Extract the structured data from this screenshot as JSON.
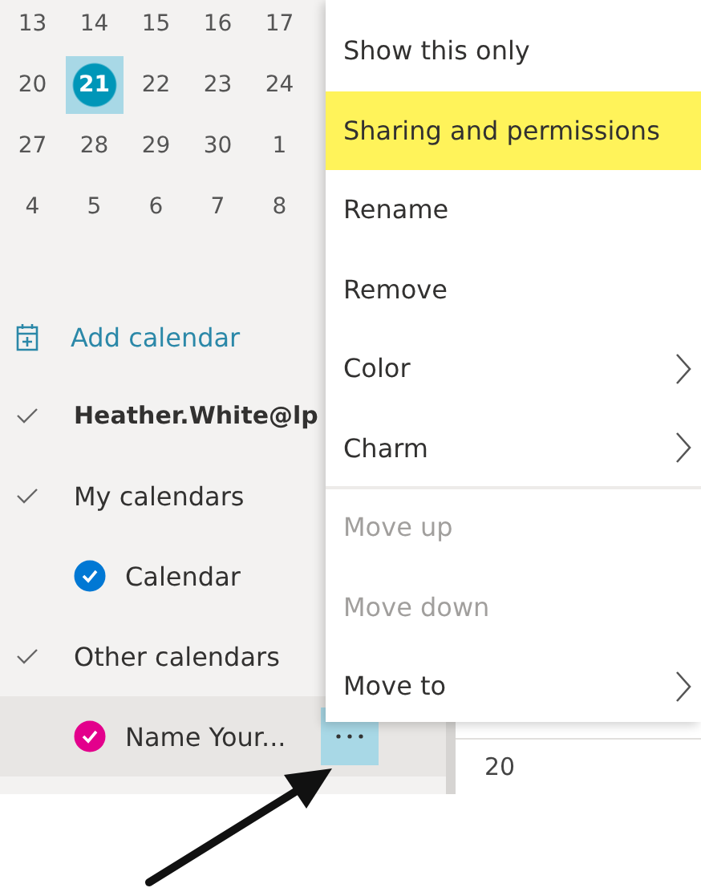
{
  "mini_calendar": {
    "weeks": [
      [
        {
          "day": "13",
          "selected": false
        },
        {
          "day": "14",
          "selected": false
        },
        {
          "day": "15",
          "selected": false
        },
        {
          "day": "16",
          "selected": false
        },
        {
          "day": "17",
          "selected": false
        }
      ],
      [
        {
          "day": "20",
          "selected": false
        },
        {
          "day": "21",
          "selected": true
        },
        {
          "day": "22",
          "selected": false
        },
        {
          "day": "23",
          "selected": false
        },
        {
          "day": "24",
          "selected": false
        }
      ],
      [
        {
          "day": "27",
          "selected": false
        },
        {
          "day": "28",
          "selected": false
        },
        {
          "day": "29",
          "selected": false
        },
        {
          "day": "30",
          "selected": false
        },
        {
          "day": "1",
          "selected": false
        }
      ],
      [
        {
          "day": "4",
          "selected": false
        },
        {
          "day": "5",
          "selected": false
        },
        {
          "day": "6",
          "selected": false
        },
        {
          "day": "7",
          "selected": false
        },
        {
          "day": "8",
          "selected": false
        }
      ]
    ]
  },
  "sidebar": {
    "add_calendar": "Add calendar",
    "account": {
      "label": "Heather.White@lp",
      "expanded": true
    },
    "groups": [
      {
        "label": "My calendars",
        "expanded": true,
        "calendars": [
          {
            "name": "Calendar",
            "color": "#0078d4",
            "checked": true,
            "selected": false
          }
        ]
      },
      {
        "label": "Other calendars",
        "expanded": true,
        "calendars": [
          {
            "name": "Name Your...",
            "color": "#e3008c",
            "checked": true,
            "selected": true
          }
        ]
      }
    ]
  },
  "calendar_view": {
    "day": "20"
  },
  "context_menu": {
    "items": [
      {
        "label": "Show this only",
        "disabled": false,
        "highlighted": false,
        "submenu": false,
        "divider_before": false
      },
      {
        "label": "Sharing and permissions",
        "disabled": false,
        "highlighted": true,
        "submenu": false,
        "divider_before": false
      },
      {
        "label": "Rename",
        "disabled": false,
        "highlighted": false,
        "submenu": false,
        "divider_before": false
      },
      {
        "label": "Remove",
        "disabled": false,
        "highlighted": false,
        "submenu": false,
        "divider_before": false
      },
      {
        "label": "Color",
        "disabled": false,
        "highlighted": false,
        "submenu": true,
        "divider_before": false
      },
      {
        "label": "Charm",
        "disabled": false,
        "highlighted": false,
        "submenu": true,
        "divider_before": false
      },
      {
        "label": "Move up",
        "disabled": true,
        "highlighted": false,
        "submenu": false,
        "divider_before": true
      },
      {
        "label": "Move down",
        "disabled": true,
        "highlighted": false,
        "submenu": false,
        "divider_before": false
      },
      {
        "label": "Move to",
        "disabled": false,
        "highlighted": false,
        "submenu": true,
        "divider_before": false
      }
    ]
  }
}
